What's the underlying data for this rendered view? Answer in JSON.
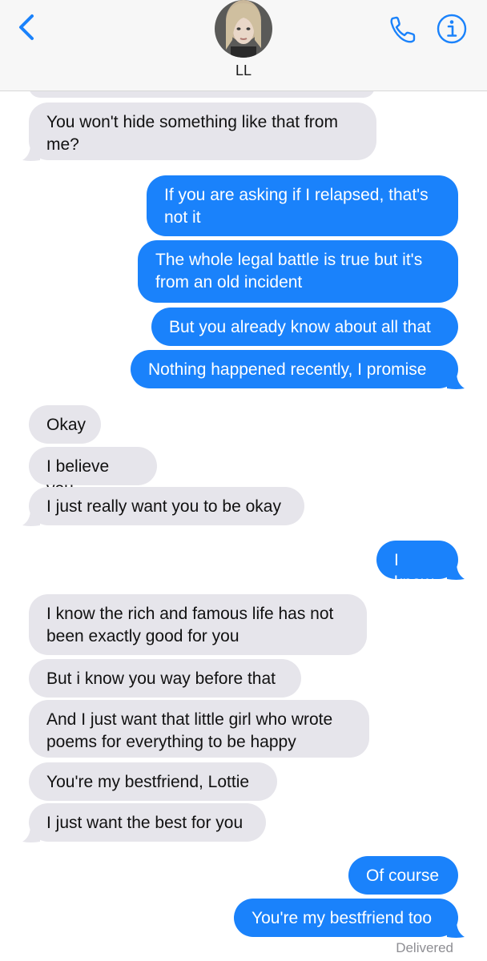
{
  "header": {
    "contact_name": "LL",
    "back_icon": "chevron-left-icon",
    "call_icon": "phone-icon",
    "info_icon": "info-icon",
    "accent_color": "#1a82fb"
  },
  "messages": [
    {
      "from": "them",
      "text": "You won't hide something like that from me?"
    },
    {
      "from": "me",
      "text": "If you are asking if I relapsed, that's not it"
    },
    {
      "from": "me",
      "text": "The whole legal battle is true but it's from an old incident"
    },
    {
      "from": "me",
      "text": "But you already know about all that"
    },
    {
      "from": "me",
      "text": "Nothing happened recently, I promise"
    },
    {
      "from": "them",
      "text": "Okay"
    },
    {
      "from": "them",
      "text": "I believe you"
    },
    {
      "from": "them",
      "text": "I just really want you to be okay"
    },
    {
      "from": "me",
      "text": "I know"
    },
    {
      "from": "them",
      "text": "I know the rich and famous life has not been exactly good for you"
    },
    {
      "from": "them",
      "text": "But i know you way before that"
    },
    {
      "from": "them",
      "text": "And I just want that little girl who wrote poems for everything to be happy"
    },
    {
      "from": "them",
      "text": "You're my bestfriend, Lottie"
    },
    {
      "from": "them",
      "text": "I just want the best for you"
    },
    {
      "from": "me",
      "text": "Of course"
    },
    {
      "from": "me",
      "text": "You're my bestfriend too"
    }
  ],
  "status": {
    "delivered": "Delivered"
  },
  "colors": {
    "incoming_bubble": "#e6e5eb",
    "outgoing_bubble": "#1a82fb"
  }
}
